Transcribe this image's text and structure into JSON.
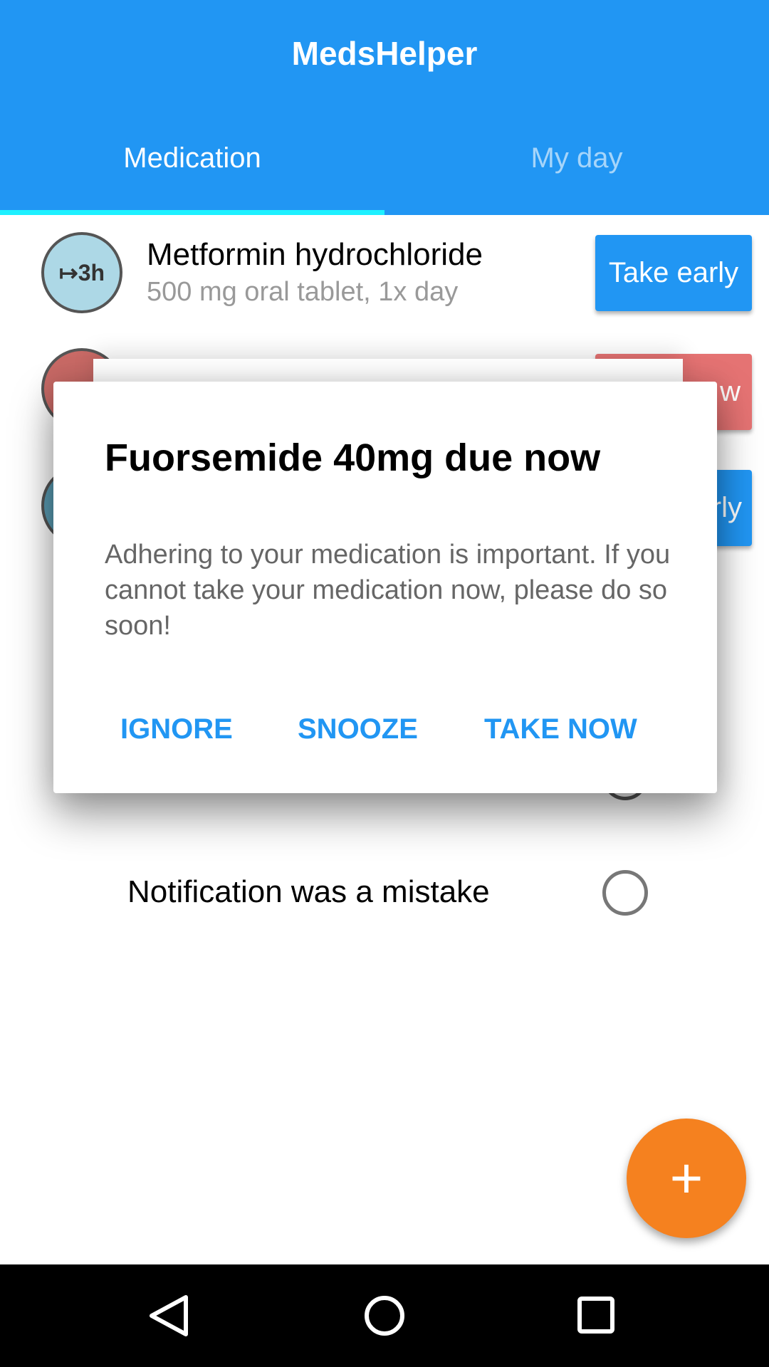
{
  "app": {
    "title": "MedsHelper"
  },
  "tabs": [
    {
      "label": "Medication"
    },
    {
      "label": "My day"
    }
  ],
  "medications": [
    {
      "name": "Metformin hydrochloride",
      "detail": "500 mg oral tablet, 1x day",
      "badge": "↦3h",
      "action": "Take early"
    },
    {
      "action_partial": "w"
    },
    {
      "action_partial": "rly"
    }
  ],
  "dialog": {
    "title": "Fuorsemide 40mg due now",
    "body": "Adhering to your medication is important. If you cannot take your medication now, please do so soon!",
    "buttons": [
      "IGNORE",
      "SNOOZE",
      "TAKE NOW"
    ]
  },
  "options": [
    {
      "label": "Notification was a mistake"
    }
  ],
  "fab": {
    "label": "+"
  },
  "colors": {
    "primary": "#2196F3",
    "accent": "#F5811F",
    "indicator": "#1EF0FF",
    "danger": "#E57373"
  }
}
